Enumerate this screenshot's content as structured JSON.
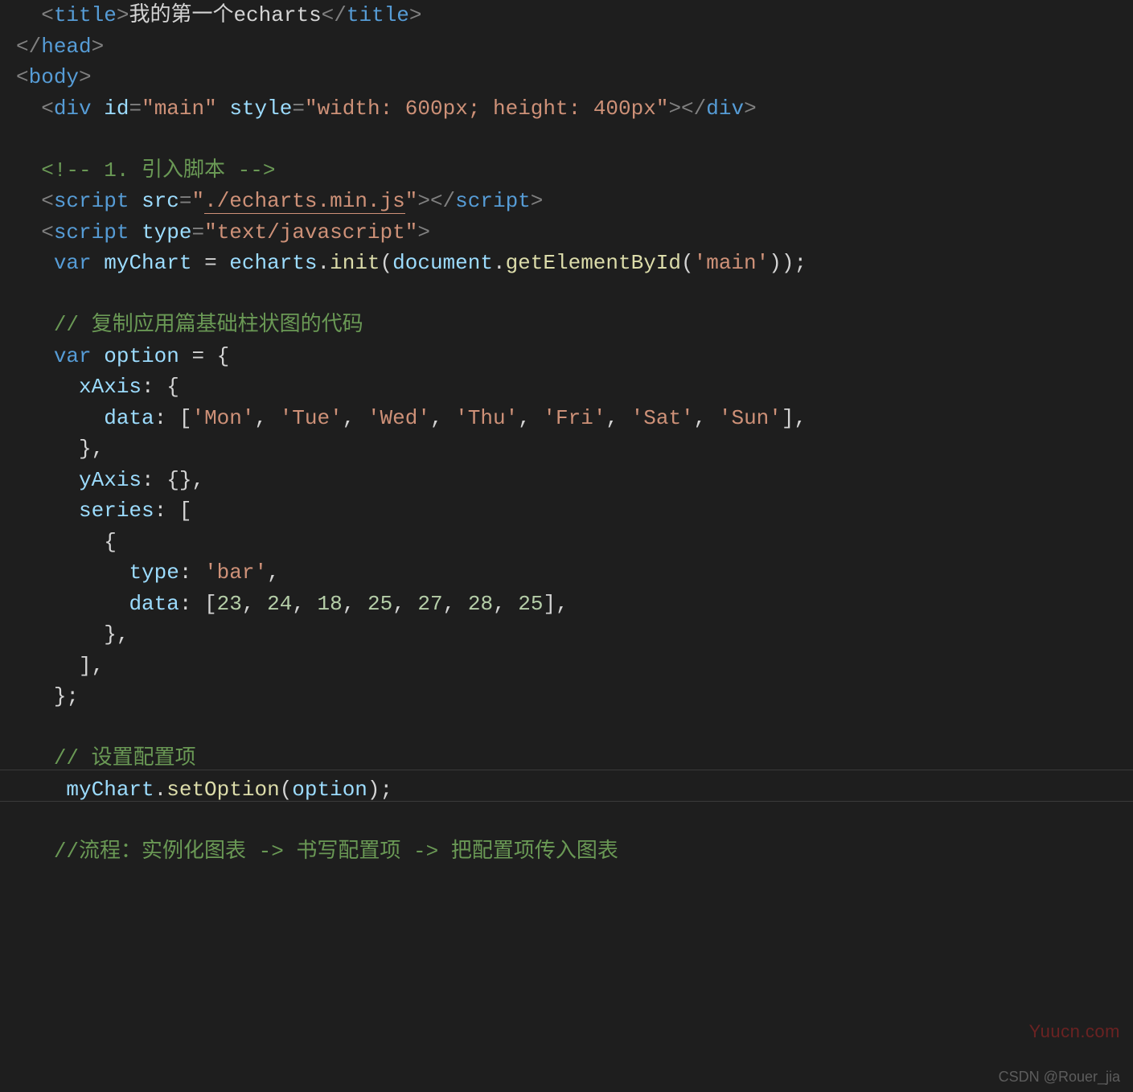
{
  "code": {
    "title_text": "我的第一个echarts",
    "div_id": "main",
    "div_style": "width: 600px; height: 400px",
    "comment_import": "1. 引入脚本",
    "script_src": "./echarts.min.js",
    "script_type": "text/javascript",
    "chart_var": "myChart",
    "echarts_obj": "echarts",
    "init_fn": "init",
    "getel_fn": "getElementById",
    "getel_arg": "'main'",
    "comment_option": "// 复制应用篇基础柱状图的代码",
    "option_var": "option",
    "xaxis_data": "['Mon', 'Tue', 'Wed', 'Thu', 'Fri', 'Sat', 'Sun']",
    "series_type": "'bar'",
    "series_data": "[23, 24, 18, 25, 27, 28, 25]",
    "comment_set": "// 设置配置项",
    "setoption_fn": "setOption",
    "comment_flow": "//流程：实例化图表 -> 书写配置项 -> 把配置项传入图表"
  },
  "chart_data": {
    "type": "bar",
    "title": "我的第一个echarts",
    "categories": [
      "Mon",
      "Tue",
      "Wed",
      "Thu",
      "Fri",
      "Sat",
      "Sun"
    ],
    "values": [
      23,
      24,
      18,
      25,
      27,
      28,
      25
    ],
    "xlabel": "",
    "ylabel": "",
    "ylim": [
      0,
      30
    ]
  },
  "watermarks": {
    "right": "Yuucn.com",
    "bottom": "CSDN @Rouer_jia"
  }
}
